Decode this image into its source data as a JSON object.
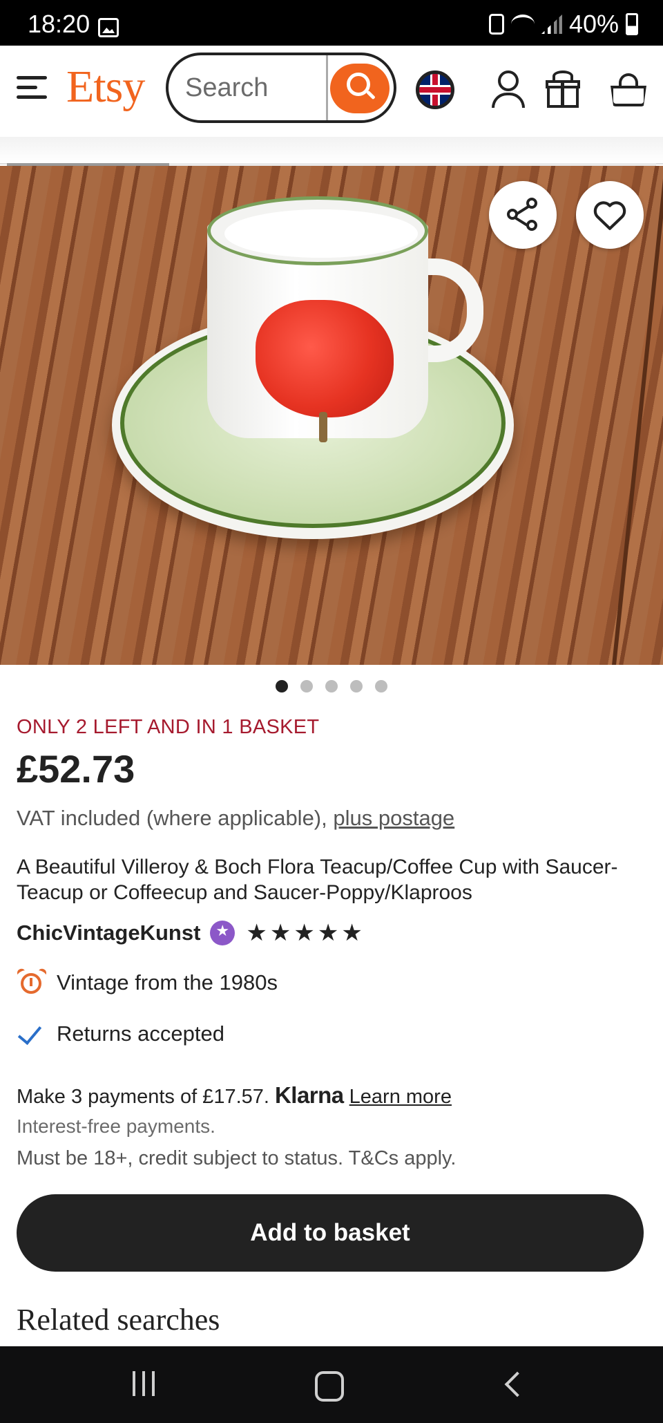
{
  "status_bar": {
    "time": "18:20",
    "battery": "40%",
    "icons": [
      "gallery-icon",
      "lock-icon",
      "wifi-icon",
      "signal-icon",
      "battery-icon"
    ]
  },
  "header": {
    "logo": "Etsy",
    "search_placeholder": "Search",
    "icons": [
      "menu-icon",
      "search-icon",
      "uk-flag-icon",
      "user-icon",
      "gift-icon",
      "basket-icon"
    ],
    "brand_color": "#f1641e"
  },
  "gallery": {
    "image_count": 5,
    "active_index": 0,
    "progress_fraction": 0.25
  },
  "listing": {
    "stock_notice": "ONLY 2 LEFT AND IN 1 BASKET",
    "price": "£52.73",
    "vat_text": "VAT included (where applicable),",
    "postage_link": "plus postage",
    "title": "A Beautiful Villeroy & Boch Flora Teacup/Coffee Cup with Saucer- Teacup or Coffeecup and Saucer-Poppy/Klaproos",
    "shop_name": "ChicVintageKunst",
    "rating_stars": 5,
    "features": [
      {
        "icon": "alarm-clock-icon",
        "text": "Vintage from the 1980s"
      },
      {
        "icon": "checkmark-icon",
        "text": "Returns accepted"
      }
    ]
  },
  "klarna": {
    "payments_text": "Make 3 payments of £17.57.",
    "brand": "Klarna",
    "learn_more": "Learn more",
    "interest": "Interest-free payments.",
    "terms": "Must be 18+, credit subject to status. T&Cs apply."
  },
  "actions": {
    "add_to_basket": "Add to basket"
  },
  "related": {
    "heading": "Related searches"
  },
  "colors": {
    "stock_red": "#a61a2e",
    "star_seller_purple": "#8c58c8",
    "button_dark": "#222222"
  }
}
